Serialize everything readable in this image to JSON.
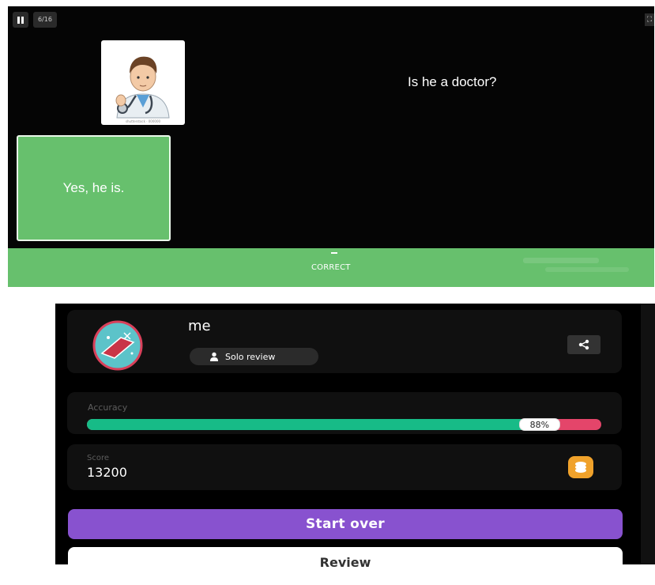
{
  "quiz": {
    "counter": "6/16",
    "question": "Is he a doctor?",
    "image_caption": "shutterstock · 000000",
    "answer": "Yes, he is.",
    "feedback": "CORRECT",
    "icons": {
      "pause": "pause-icon",
      "fullscreen": "fullscreen-icon"
    }
  },
  "summary": {
    "player_name": "me",
    "mode": "Solo review",
    "accuracy_label": "Accuracy",
    "accuracy_value": "88%",
    "accuracy_fraction": 0.88,
    "score_label": "Score",
    "score_value": "13200",
    "buttons": {
      "start_over": "Start over",
      "review": "Review"
    },
    "icons": {
      "user": "user-icon",
      "share": "share-icon",
      "coins": "coins-icon",
      "avatar": "avatar-icon"
    },
    "colors": {
      "accuracy_fill": "#17bb87",
      "accuracy_track": "#e4456a",
      "start_over": "#8852cf",
      "coins": "#f0a22b"
    }
  }
}
